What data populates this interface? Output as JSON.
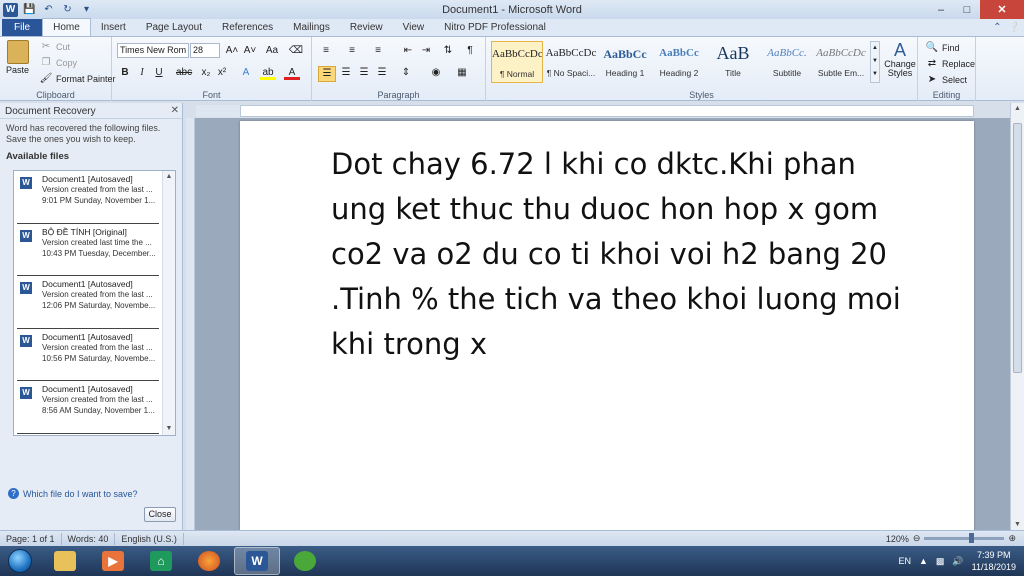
{
  "window": {
    "title": "Document1 - Microsoft Word"
  },
  "tabs": [
    "File",
    "Home",
    "Insert",
    "Page Layout",
    "References",
    "Mailings",
    "Review",
    "View",
    "Nitro PDF Professional"
  ],
  "ribbon": {
    "clipboard": {
      "label": "Clipboard",
      "paste": "Paste",
      "cut": "Cut",
      "copy": "Copy",
      "format_painter": "Format Painter"
    },
    "font": {
      "label": "Font",
      "name": "Times New Rom",
      "size": "28"
    },
    "paragraph": {
      "label": "Paragraph"
    },
    "styles": {
      "label": "Styles",
      "items": [
        {
          "sample": "AaBbCcDc",
          "name": "¶ Normal"
        },
        {
          "sample": "AaBbCcDc",
          "name": "¶ No Spaci..."
        },
        {
          "sample": "AaBbCc",
          "name": "Heading 1"
        },
        {
          "sample": "AaBbCc",
          "name": "Heading 2"
        },
        {
          "sample": "AaB",
          "name": "Title"
        },
        {
          "sample": "AaBbCc.",
          "name": "Subtitle"
        },
        {
          "sample": "AaBbCcDc",
          "name": "Subtle Em..."
        }
      ],
      "change_styles": "Change Styles"
    },
    "editing": {
      "label": "Editing",
      "find": "Find",
      "replace": "Replace",
      "select": "Select"
    }
  },
  "pane": {
    "title": "Document Recovery",
    "info": "Word has recovered the following files.  Save the ones you wish to keep.",
    "available": "Available files",
    "files": [
      {
        "name": "Document1  [Autosaved]",
        "line2": "Version created from the last ...",
        "line3": "9:01 PM Sunday, November 1..."
      },
      {
        "name": "BỘ ĐỀ TÍNH  [Original]",
        "line2": "Version created last time the ...",
        "line3": "10:43 PM Tuesday, December..."
      },
      {
        "name": "Document1  [Autosaved]",
        "line2": "Version created from the last ...",
        "line3": "12:06 PM Saturday, Novembe..."
      },
      {
        "name": "Document1  [Autosaved]",
        "line2": "Version created from the last ...",
        "line3": "10:56 PM Saturday, Novembe..."
      },
      {
        "name": "Document1  [Autosaved]",
        "line2": "Version created from the last ...",
        "line3": "8:56 AM Sunday, November 1..."
      }
    ],
    "which_link": "Which file do I want to save?",
    "close": "Close"
  },
  "document": {
    "text": "Dot chay 6.72 l khi co dktc.Khi phan ung ket thuc thu duoc hon hop x gom co2 va o2 du co ti khoi voi h2 bang 20 .Tinh % the tich va theo khoi luong moi khi trong x"
  },
  "status": {
    "page": "Page: 1 of 1",
    "words": "Words: 40",
    "language": "English (U.S.)",
    "zoom": "120%",
    "zoom_fraction": 0.6
  },
  "taskbar": {
    "lang": "EN",
    "time": "7:39 PM",
    "date": "11/18/2019"
  }
}
